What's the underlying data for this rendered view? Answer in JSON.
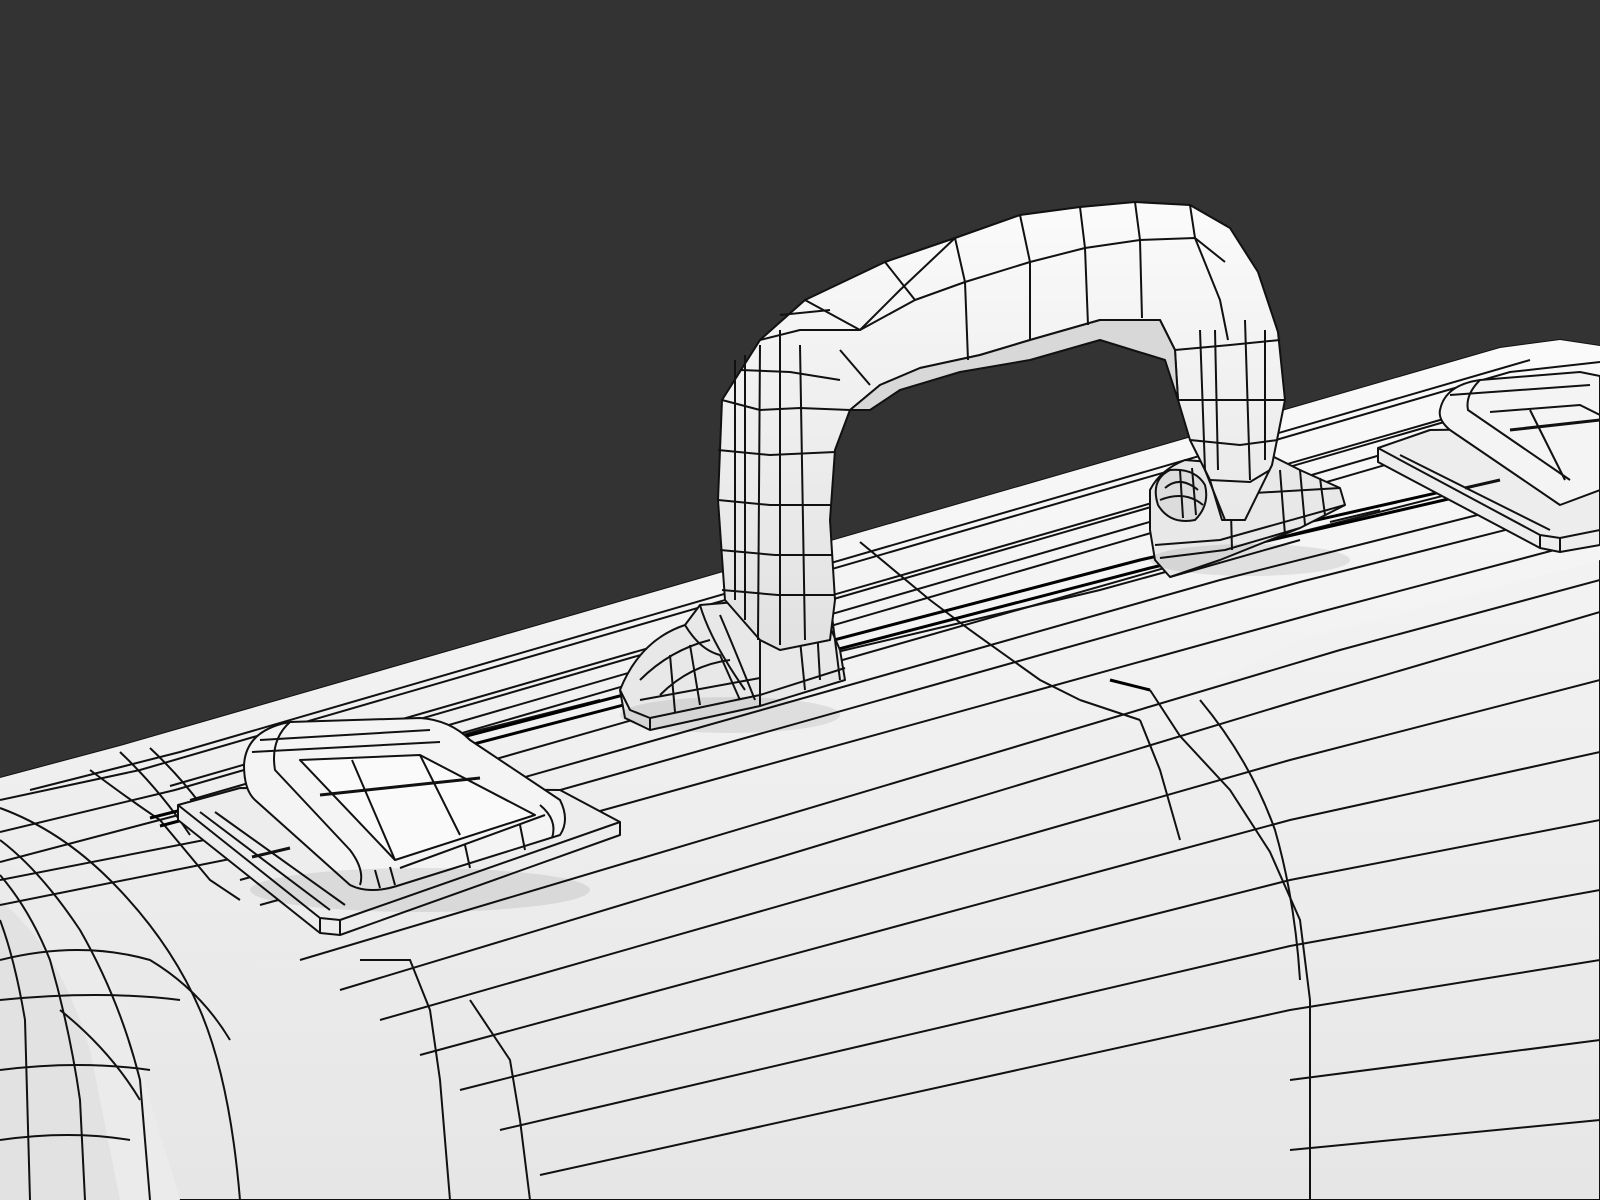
{
  "scene": {
    "subject": "briefcase-wireframe-render",
    "colors": {
      "background": "#333333",
      "surface": "#f4f4f4",
      "surface_shade": "#dedede",
      "surface_dark": "#c9c9c9",
      "wire": "#111111"
    },
    "parts": [
      "case-body",
      "carry-handle",
      "handle-mount-left",
      "handle-mount-right",
      "latch-left",
      "latch-right"
    ]
  }
}
